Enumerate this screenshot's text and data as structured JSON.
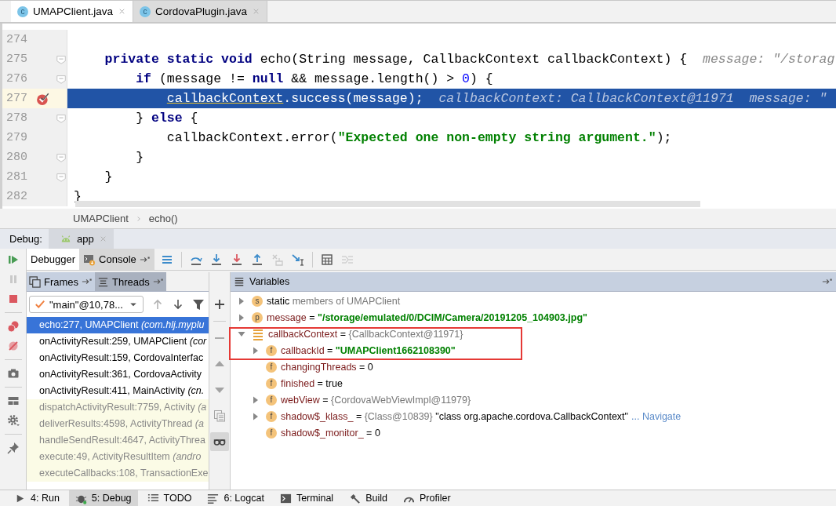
{
  "editor_tabs": [
    {
      "icon_letter": "c",
      "label": "UMAPClient.java",
      "selected": true
    },
    {
      "icon_letter": "c",
      "label": "CordovaPlugin.java",
      "selected": false
    }
  ],
  "code_lines": [
    {
      "number": "274",
      "fold": false,
      "breakpoint": false,
      "current": false
    },
    {
      "number": "275",
      "fold": true,
      "breakpoint": false,
      "current": false,
      "code": [
        {
          "kind": "keyword",
          "text": "    private static void"
        },
        {
          "kind": "plain",
          "text": " echo(String message, CallbackContext callbackContext) {"
        }
      ],
      "hints": [
        "message: \"/storag"
      ]
    },
    {
      "number": "276",
      "fold": true,
      "breakpoint": false,
      "current": false,
      "code": [
        {
          "kind": "keyword",
          "text": "        if"
        },
        {
          "kind": "plain",
          "text": " (message != "
        },
        {
          "kind": "keyword",
          "text": "null"
        },
        {
          "kind": "plain",
          "text": " && message.length() > "
        },
        {
          "kind": "number",
          "text": "0"
        },
        {
          "kind": "plain",
          "text": ") {"
        }
      ]
    },
    {
      "number": "277",
      "fold": false,
      "breakpoint": true,
      "current": true,
      "code": [
        {
          "kind": "usage",
          "text": "            callbackContext"
        },
        {
          "kind": "plain",
          "text": ".success(message);"
        }
      ],
      "hints": [
        "callbackContext: CallbackContext@11971",
        "message: \""
      ]
    },
    {
      "number": "278",
      "fold": true,
      "breakpoint": false,
      "current": false,
      "code": [
        {
          "kind": "plain",
          "text": "        } "
        },
        {
          "kind": "keyword",
          "text": "else"
        },
        {
          "kind": "plain",
          "text": " {"
        }
      ]
    },
    {
      "number": "279",
      "fold": false,
      "breakpoint": false,
      "current": false,
      "code": [
        {
          "kind": "plain",
          "text": "            callbackContext.error("
        },
        {
          "kind": "string",
          "text": "\"Expected one non-empty string argument.\""
        },
        {
          "kind": "plain",
          "text": ");"
        }
      ]
    },
    {
      "number": "280",
      "fold": true,
      "breakpoint": false,
      "current": false,
      "code": [
        {
          "kind": "plain",
          "text": "        }"
        }
      ]
    },
    {
      "number": "281",
      "fold": true,
      "breakpoint": false,
      "current": false,
      "code": [
        {
          "kind": "plain",
          "text": "    }"
        }
      ]
    },
    {
      "number": "282",
      "fold": false,
      "breakpoint": false,
      "current": false,
      "code": [
        {
          "kind": "plain",
          "text": "}"
        }
      ]
    }
  ],
  "breadcrumbs": [
    "UMAPClient",
    "echo()"
  ],
  "debug_header": {
    "title": "Debug:",
    "tab": "app"
  },
  "left_toolbar": [
    {
      "disabled": false
    },
    {
      "disabled": true
    },
    {
      "disabled": false
    },
    {
      "disabled": false
    },
    {
      "disabled": false
    },
    {
      "disabled": false
    },
    {
      "disabled": false
    },
    {
      "disabled": false
    },
    {
      "disabled": false
    }
  ],
  "debugger_tabs": [
    {
      "label": "Debugger",
      "selected": true
    },
    {
      "label": "Console",
      "selected": false
    }
  ],
  "debugger_toolbar": [
    {
      "disabled": false
    },
    {
      "disabled": false
    },
    {
      "disabled": false
    },
    {
      "disabled": false
    },
    {
      "disabled": false
    },
    {
      "disabled": true
    },
    {
      "disabled": false
    },
    {
      "disabled": false
    },
    {
      "disabled": true
    }
  ],
  "frames_tabs": [
    {
      "label": "Frames",
      "selected": true
    },
    {
      "label": "Threads",
      "selected": false
    }
  ],
  "thread_selector": {
    "value": "\"main\"@10,78..."
  },
  "frames_toolbar": [
    {
      "disabled": true
    },
    {
      "disabled": false
    },
    {
      "disabled": false
    }
  ],
  "frames": [
    {
      "text": "echo:277, UMAPClient *(com.hlj.myplu*",
      "selected": true,
      "library": false
    },
    {
      "text": "onActivityResult:259, UMAPClient *(cor*",
      "selected": false,
      "library": false
    },
    {
      "text": "onActivityResult:159, CordovaInterfac",
      "selected": false,
      "library": false
    },
    {
      "text": "onActivityResult:361, CordovaActivity",
      "selected": false,
      "library": false
    },
    {
      "text": "onActivityResult:411, MainActivity *(cn.*",
      "selected": false,
      "library": false
    },
    {
      "text": "dispatchActivityResult:7759, Activity *(a*",
      "selected": false,
      "library": true
    },
    {
      "text": "deliverResults:4598, ActivityThread *(a*",
      "selected": false,
      "library": true
    },
    {
      "text": "handleSendResult:4647, ActivityThrea",
      "selected": false,
      "library": true
    },
    {
      "text": "execute:49, ActivityResultItem *(andro*",
      "selected": false,
      "library": true
    },
    {
      "text": "executeCallbacks:108, TransactionExe",
      "selected": false,
      "library": true
    }
  ],
  "variables_toolbar": [
    {
      "disabled": false,
      "selected": false
    },
    {
      "disabled": true,
      "selected": false
    },
    {
      "disabled": true,
      "selected": false
    },
    {
      "disabled": true,
      "selected": false
    },
    {
      "disabled": true,
      "selected": false
    },
    {
      "disabled": false,
      "selected": true
    }
  ],
  "variables_title": "Variables",
  "variables": [
    {
      "kind": "static",
      "badge": "s",
      "name": "static",
      "note": "members of UMAPClient",
      "expandable": true,
      "expanded": false,
      "highlighted": false
    },
    {
      "kind": "param",
      "badge": "p",
      "name": "message",
      "separator": "=",
      "value": {
        "kind": "string",
        "text": "\"/storage/emulated/0/DCIM/Camera/20191205_104903.jpg\""
      },
      "expandable": true,
      "expanded": false,
      "highlighted": false
    },
    {
      "kind": "local",
      "name": "callbackContext",
      "separator": "=",
      "value": {
        "kind": "ref",
        "text": "{CallbackContext@11971}"
      },
      "expandable": true,
      "expanded": true,
      "highlighted": true,
      "children": [
        {
          "kind": "field",
          "badge": "f",
          "name": "callbackId",
          "separator": "=",
          "value": {
            "kind": "string",
            "text": "\"UMAPClient1662108390\""
          },
          "expandable": true,
          "expanded": false,
          "highlighted": true
        },
        {
          "kind": "field",
          "badge": "f",
          "name": "changingThreads",
          "separator": "=",
          "value": {
            "kind": "plain",
            "text": "0"
          },
          "expandable": false,
          "highlighted": false
        },
        {
          "kind": "field",
          "badge": "f",
          "name": "finished",
          "separator": "=",
          "value": {
            "kind": "plain",
            "text": "true"
          },
          "expandable": false,
          "highlighted": false
        },
        {
          "kind": "field",
          "badge": "f",
          "name": "webView",
          "separator": "=",
          "value": {
            "kind": "ref",
            "text": "{CordovaWebViewImpl@11979}"
          },
          "expandable": true,
          "expanded": false,
          "highlighted": false
        },
        {
          "kind": "field",
          "badge": "f",
          "name": "shadow$_klass_",
          "separator": "=",
          "value": {
            "kind": "ref",
            "text": "{Class@10839}"
          },
          "extra": "\"class org.apache.cordova.CallbackContext\"",
          "link": "... Navigate",
          "expandable": true,
          "expanded": false,
          "highlighted": false
        },
        {
          "kind": "field",
          "badge": "f",
          "name": "shadow$_monitor_",
          "separator": "=",
          "value": {
            "kind": "plain",
            "text": "0"
          },
          "expandable": false,
          "highlighted": false
        }
      ]
    }
  ],
  "bottom_tools": [
    {
      "label": "4: Run",
      "selected": false
    },
    {
      "label": "5: Debug",
      "selected": true
    },
    {
      "label": "TODO",
      "selected": false
    },
    {
      "label": "6: Logcat",
      "selected": false
    },
    {
      "label": "Terminal",
      "selected": false
    },
    {
      "label": "Build",
      "selected": false
    },
    {
      "label": "Profiler",
      "selected": false
    }
  ]
}
